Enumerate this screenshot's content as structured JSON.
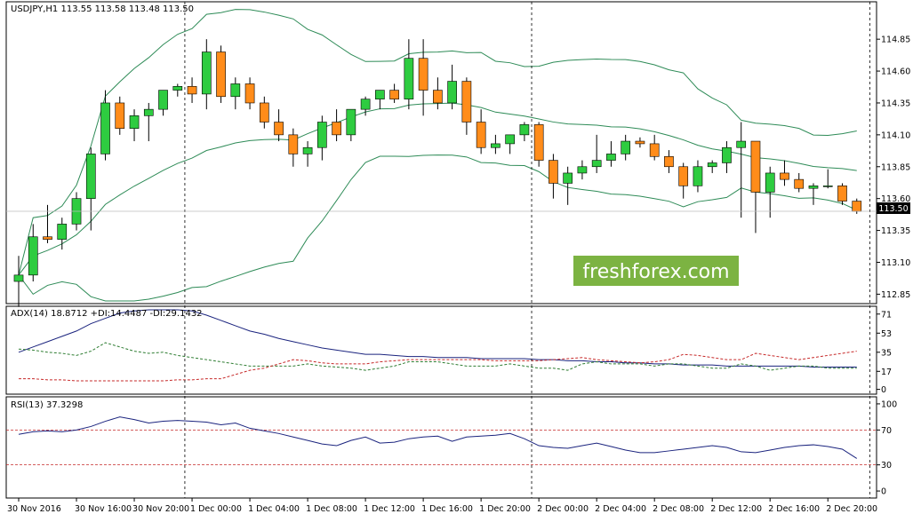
{
  "chart_data": [
    {
      "type": "candlestick",
      "header": "USDJPY,H1  113.55 113.58 113.48 113.50",
      "price_labels": [
        "114.85",
        "114.60",
        "114.35",
        "114.10",
        "113.85",
        "113.60",
        "113.35",
        "113.10",
        "112.85"
      ],
      "price_ticks": [
        114.85,
        114.6,
        114.35,
        114.1,
        113.85,
        113.6,
        113.35,
        113.1,
        112.85
      ],
      "ylim": [
        112.79,
        115.06
      ],
      "current_price": "113.50",
      "time_labels": [
        "30 Nov 2016",
        "30 Nov 16:00",
        "30 Nov 20:00",
        "1 Dec 00:00",
        "1 Dec 04:00",
        "1 Dec 08:00",
        "1 Dec 12:00",
        "1 Dec 16:00",
        "1 Dec 20:00",
        "2 Dec 00:00",
        "2 Dec 04:00",
        "2 Dec 08:00",
        "2 Dec 12:00",
        "2 Dec 16:00",
        "2 Dec 20:00"
      ],
      "colors": {
        "up": "#2ecc40",
        "down": "#ff8c1a",
        "band": "#2e8b57"
      },
      "candles": [
        [
          112.95,
          113.15,
          112.75,
          113.0
        ],
        [
          113.0,
          113.4,
          112.95,
          113.3
        ],
        [
          113.3,
          113.55,
          113.25,
          113.28
        ],
        [
          113.28,
          113.45,
          113.2,
          113.4
        ],
        [
          113.4,
          113.65,
          113.35,
          113.6
        ],
        [
          113.6,
          114.0,
          113.35,
          113.95
        ],
        [
          113.95,
          114.45,
          113.9,
          114.35
        ],
        [
          114.35,
          114.4,
          114.1,
          114.15
        ],
        [
          114.15,
          114.3,
          114.05,
          114.25
        ],
        [
          114.25,
          114.35,
          114.05,
          114.3
        ],
        [
          114.3,
          114.45,
          114.25,
          114.45
        ],
        [
          114.45,
          114.5,
          114.4,
          114.48
        ],
        [
          114.48,
          114.55,
          114.35,
          114.42
        ],
        [
          114.42,
          114.85,
          114.3,
          114.75
        ],
        [
          114.75,
          114.8,
          114.35,
          114.4
        ],
        [
          114.4,
          114.55,
          114.3,
          114.5
        ],
        [
          114.5,
          114.55,
          114.3,
          114.35
        ],
        [
          114.35,
          114.4,
          114.15,
          114.2
        ],
        [
          114.2,
          114.3,
          114.05,
          114.1
        ],
        [
          114.1,
          114.15,
          113.85,
          113.95
        ],
        [
          113.95,
          114.05,
          113.85,
          114.0
        ],
        [
          114.0,
          114.25,
          113.9,
          114.2
        ],
        [
          114.2,
          114.3,
          114.05,
          114.1
        ],
        [
          114.1,
          114.25,
          114.05,
          114.3
        ],
        [
          114.3,
          114.4,
          114.25,
          114.38
        ],
        [
          114.38,
          114.45,
          114.3,
          114.45
        ],
        [
          114.45,
          114.5,
          114.35,
          114.38
        ],
        [
          114.38,
          114.85,
          114.3,
          114.7
        ],
        [
          114.7,
          114.85,
          114.25,
          114.45
        ],
        [
          114.45,
          114.55,
          114.3,
          114.35
        ],
        [
          114.35,
          114.65,
          114.3,
          114.52
        ],
        [
          114.52,
          114.55,
          114.1,
          114.2
        ],
        [
          114.2,
          114.3,
          113.95,
          114.0
        ],
        [
          114.0,
          114.1,
          113.95,
          114.03
        ],
        [
          114.03,
          114.1,
          113.95,
          114.1
        ],
        [
          114.1,
          114.2,
          114.05,
          114.18
        ],
        [
          114.18,
          114.2,
          113.85,
          113.9
        ],
        [
          113.9,
          113.95,
          113.6,
          113.72
        ],
        [
          113.72,
          113.85,
          113.55,
          113.8
        ],
        [
          113.8,
          113.9,
          113.75,
          113.85
        ],
        [
          113.85,
          114.1,
          113.8,
          113.9
        ],
        [
          113.9,
          114.05,
          113.85,
          113.95
        ],
        [
          113.95,
          114.1,
          113.9,
          114.05
        ],
        [
          114.05,
          114.08,
          114.0,
          114.03
        ],
        [
          114.03,
          114.1,
          113.9,
          113.93
        ],
        [
          113.93,
          113.98,
          113.8,
          113.85
        ],
        [
          113.85,
          113.88,
          113.6,
          113.7
        ],
        [
          113.7,
          113.9,
          113.65,
          113.85
        ],
        [
          113.85,
          113.9,
          113.8,
          113.88
        ],
        [
          113.88,
          114.05,
          113.8,
          114.0
        ],
        [
          114.0,
          114.2,
          113.45,
          114.05
        ],
        [
          114.05,
          114.05,
          113.33,
          113.65
        ],
        [
          113.65,
          113.85,
          113.45,
          113.8
        ],
        [
          113.8,
          113.9,
          113.7,
          113.75
        ],
        [
          113.75,
          113.8,
          113.65,
          113.68
        ],
        [
          113.68,
          113.72,
          113.55,
          113.7
        ],
        [
          113.7,
          113.83,
          113.68,
          113.7
        ],
        [
          113.7,
          113.72,
          113.55,
          113.58
        ],
        [
          113.58,
          113.6,
          113.48,
          113.5
        ]
      ],
      "indicators": [
        {
          "name": "ADX(14)",
          "header": "ADX(14) 18.8712 +DI:14.4487 -DI:29.1432",
          "labels": [
            "71",
            "53",
            "35",
            "17",
            "0"
          ],
          "ticks": [
            71,
            53,
            35,
            17,
            0
          ],
          "ylim": [
            -2,
            75
          ],
          "series": [
            {
              "name": "ADX",
              "color": "#1a237e",
              "dash": "",
              "values": [
                35,
                40,
                45,
                50,
                55,
                62,
                67,
                72,
                74,
                75,
                75,
                75,
                74,
                70,
                65,
                60,
                55,
                52,
                48,
                45,
                42,
                39,
                37,
                35,
                33,
                33,
                32,
                31,
                31,
                30,
                30,
                30,
                29,
                29,
                29,
                29,
                28,
                28,
                27,
                27,
                26,
                26,
                25,
                25,
                24,
                24,
                23,
                23,
                23,
                22,
                22,
                22,
                22,
                22,
                22,
                21,
                21,
                21,
                21
              ]
            },
            {
              "name": "+DI",
              "color": "#2e7d32",
              "dash": "3,2",
              "values": [
                38,
                37,
                35,
                34,
                32,
                36,
                44,
                40,
                36,
                34,
                35,
                32,
                30,
                28,
                26,
                24,
                22,
                22,
                22,
                22,
                24,
                22,
                21,
                20,
                18,
                20,
                22,
                26,
                26,
                26,
                24,
                22,
                22,
                22,
                24,
                22,
                20,
                20,
                18,
                24,
                26,
                24,
                24,
                24,
                22,
                24,
                24,
                22,
                20,
                20,
                24,
                22,
                18,
                20,
                22,
                22,
                20,
                20,
                20
              ]
            },
            {
              "name": "-DI",
              "color": "#c62828",
              "dash": "3,2",
              "values": [
                10,
                10,
                9,
                9,
                8,
                8,
                8,
                8,
                8,
                8,
                8,
                9,
                9,
                10,
                10,
                14,
                18,
                20,
                24,
                28,
                27,
                25,
                24,
                24,
                24,
                26,
                27,
                28,
                28,
                28,
                28,
                28,
                28,
                27,
                27,
                27,
                27,
                28,
                29,
                30,
                28,
                27,
                26,
                25,
                26,
                28,
                33,
                32,
                30,
                28,
                28,
                34,
                32,
                30,
                28,
                30,
                32,
                34,
                36
              ]
            }
          ]
        },
        {
          "name": "RSI(13)",
          "header": "RSI(13) 37.3298",
          "labels": [
            "100",
            "70",
            "30",
            "0"
          ],
          "ticks": [
            100,
            70,
            30,
            0
          ],
          "ylim": [
            -5,
            104
          ],
          "levels": [
            70,
            30
          ],
          "series": [
            {
              "name": "RSI",
              "color": "#1a237e",
              "dash": "",
              "values": [
                65,
                68,
                69,
                68,
                70,
                74,
                80,
                85,
                82,
                78,
                80,
                81,
                80,
                79,
                76,
                78,
                72,
                69,
                66,
                62,
                58,
                54,
                52,
                58,
                62,
                55,
                56,
                60,
                62,
                63,
                57,
                62,
                63,
                64,
                66,
                60,
                52,
                50,
                49,
                52,
                55,
                51,
                47,
                44,
                44,
                46,
                48,
                50,
                52,
                50,
                45,
                44,
                47,
                50,
                52,
                53,
                51,
                48,
                37.3
              ]
            }
          ]
        }
      ]
    }
  ],
  "watermark": "freshforex.com"
}
